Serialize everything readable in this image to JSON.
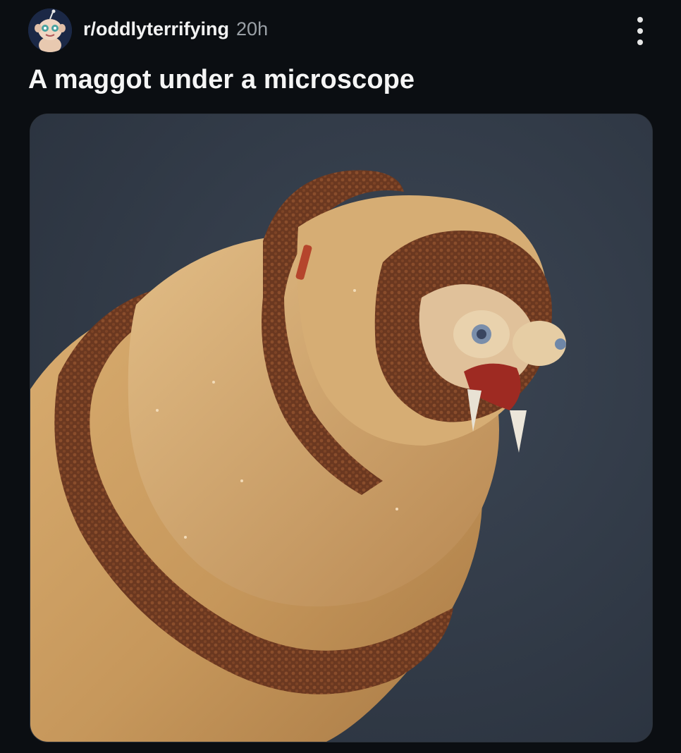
{
  "post": {
    "subreddit": "r/oddlyterrifying",
    "age": "20h",
    "title": "A maggot under a microscope",
    "avatar_icon": "snoo-avatar-icon",
    "menu_icon": "more-vertical-icon",
    "image_subject": "maggot-microscope-photo"
  },
  "colors": {
    "background": "#0b0e12",
    "text_primary": "#f2f2f2",
    "text_secondary": "#9aa0a6",
    "photo_background": "#343d4a",
    "maggot_body": "#c79a5e",
    "maggot_band": "#6e3a22"
  }
}
